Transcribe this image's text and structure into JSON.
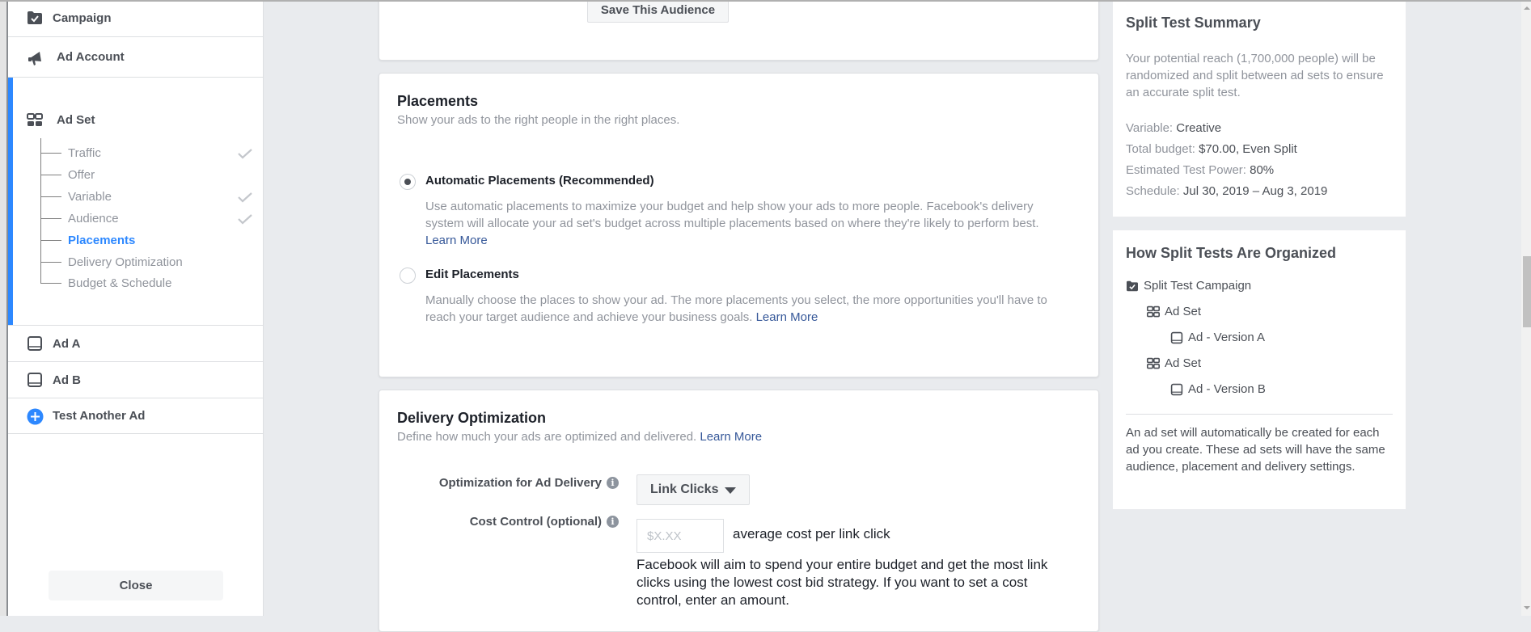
{
  "sidebar": {
    "items": [
      {
        "label": "Campaign",
        "icon": "campaign-folder-check-icon"
      },
      {
        "label": "Ad Account",
        "icon": "megaphone-icon"
      },
      {
        "label": "Ad Set",
        "icon": "ad-set-grid-icon"
      },
      {
        "label": "Ad A",
        "icon": "ad-tablet-icon"
      },
      {
        "label": "Ad B",
        "icon": "ad-tablet-icon"
      },
      {
        "label": "Test Another Ad",
        "icon": "plus-circle-icon"
      }
    ],
    "ad_set_steps": [
      {
        "label": "Traffic",
        "completed": true,
        "active": false
      },
      {
        "label": "Offer",
        "completed": false,
        "active": false
      },
      {
        "label": "Variable",
        "completed": true,
        "active": false
      },
      {
        "label": "Audience",
        "completed": true,
        "active": false
      },
      {
        "label": "Placements",
        "completed": false,
        "active": true
      },
      {
        "label": "Delivery Optimization",
        "completed": false,
        "active": false
      },
      {
        "label": "Budget & Schedule",
        "completed": false,
        "active": false
      }
    ],
    "close_label": "Close"
  },
  "colors": {
    "accent": "#2d88ff",
    "link": "#365899",
    "muted_text": "#90949c",
    "dark_text": "#4b4f56"
  },
  "audience": {
    "save_label": "Save This Audience"
  },
  "placements": {
    "title": "Placements",
    "subtitle": "Show your ads to the right people in the right places.",
    "options": [
      {
        "label": "Automatic Placements (Recommended)",
        "selected": true,
        "description": "Use automatic placements to maximize your budget and help show your ads to more people. Facebook's delivery system will allocate your ad set's budget across multiple placements based on where they're likely to perform best.",
        "link": "Learn More"
      },
      {
        "label": "Edit Placements",
        "selected": false,
        "description": "Manually choose the places to show your ad. The more placements you select, the more opportunities you'll have to reach your target audience and achieve your business goals.",
        "link": "Learn More"
      }
    ]
  },
  "delivery": {
    "title": "Delivery Optimization",
    "subtitle": "Define how much your ads are optimized and delivered.",
    "subtitle_link": "Learn More",
    "optimization_label": "Optimization for Ad Delivery",
    "optimization_value": "Link Clicks",
    "cost_control_label": "Cost Control (optional)",
    "cost_placeholder": "$X.XX",
    "cost_value": "",
    "cost_suffix": "average cost per link click",
    "cost_help": "Facebook will aim to spend your entire budget and get the most link clicks using the lowest cost bid strategy. If you want to set a cost control, enter an amount."
  },
  "summary": {
    "title": "Split Test Summary",
    "description": "Your potential reach (1,700,000 people) will be randomized and split between ad sets to ensure an accurate split test.",
    "rows": [
      {
        "label": "Variable:",
        "value": "Creative"
      },
      {
        "label": "Total budget:",
        "value": "$70.00, Even Split"
      },
      {
        "label": "Estimated Test Power:",
        "value": "80%"
      },
      {
        "label": "Schedule:",
        "value": "Jul 30, 2019 – Aug 3, 2019"
      }
    ]
  },
  "organization": {
    "title": "How Split Tests Are Organized",
    "tree": [
      {
        "label": "Split Test Campaign",
        "icon": "campaign-folder-check-icon",
        "level": 0
      },
      {
        "label": "Ad Set",
        "icon": "ad-set-grid-icon",
        "level": 1
      },
      {
        "label": "Ad - Version A",
        "icon": "ad-tablet-icon",
        "level": 2
      },
      {
        "label": "Ad Set",
        "icon": "ad-set-grid-icon",
        "level": 1
      },
      {
        "label": "Ad - Version B",
        "icon": "ad-tablet-icon",
        "level": 2
      }
    ],
    "note": "An ad set will automatically be created for each ad you create. These ad sets will have the same audience, placement and delivery settings."
  }
}
